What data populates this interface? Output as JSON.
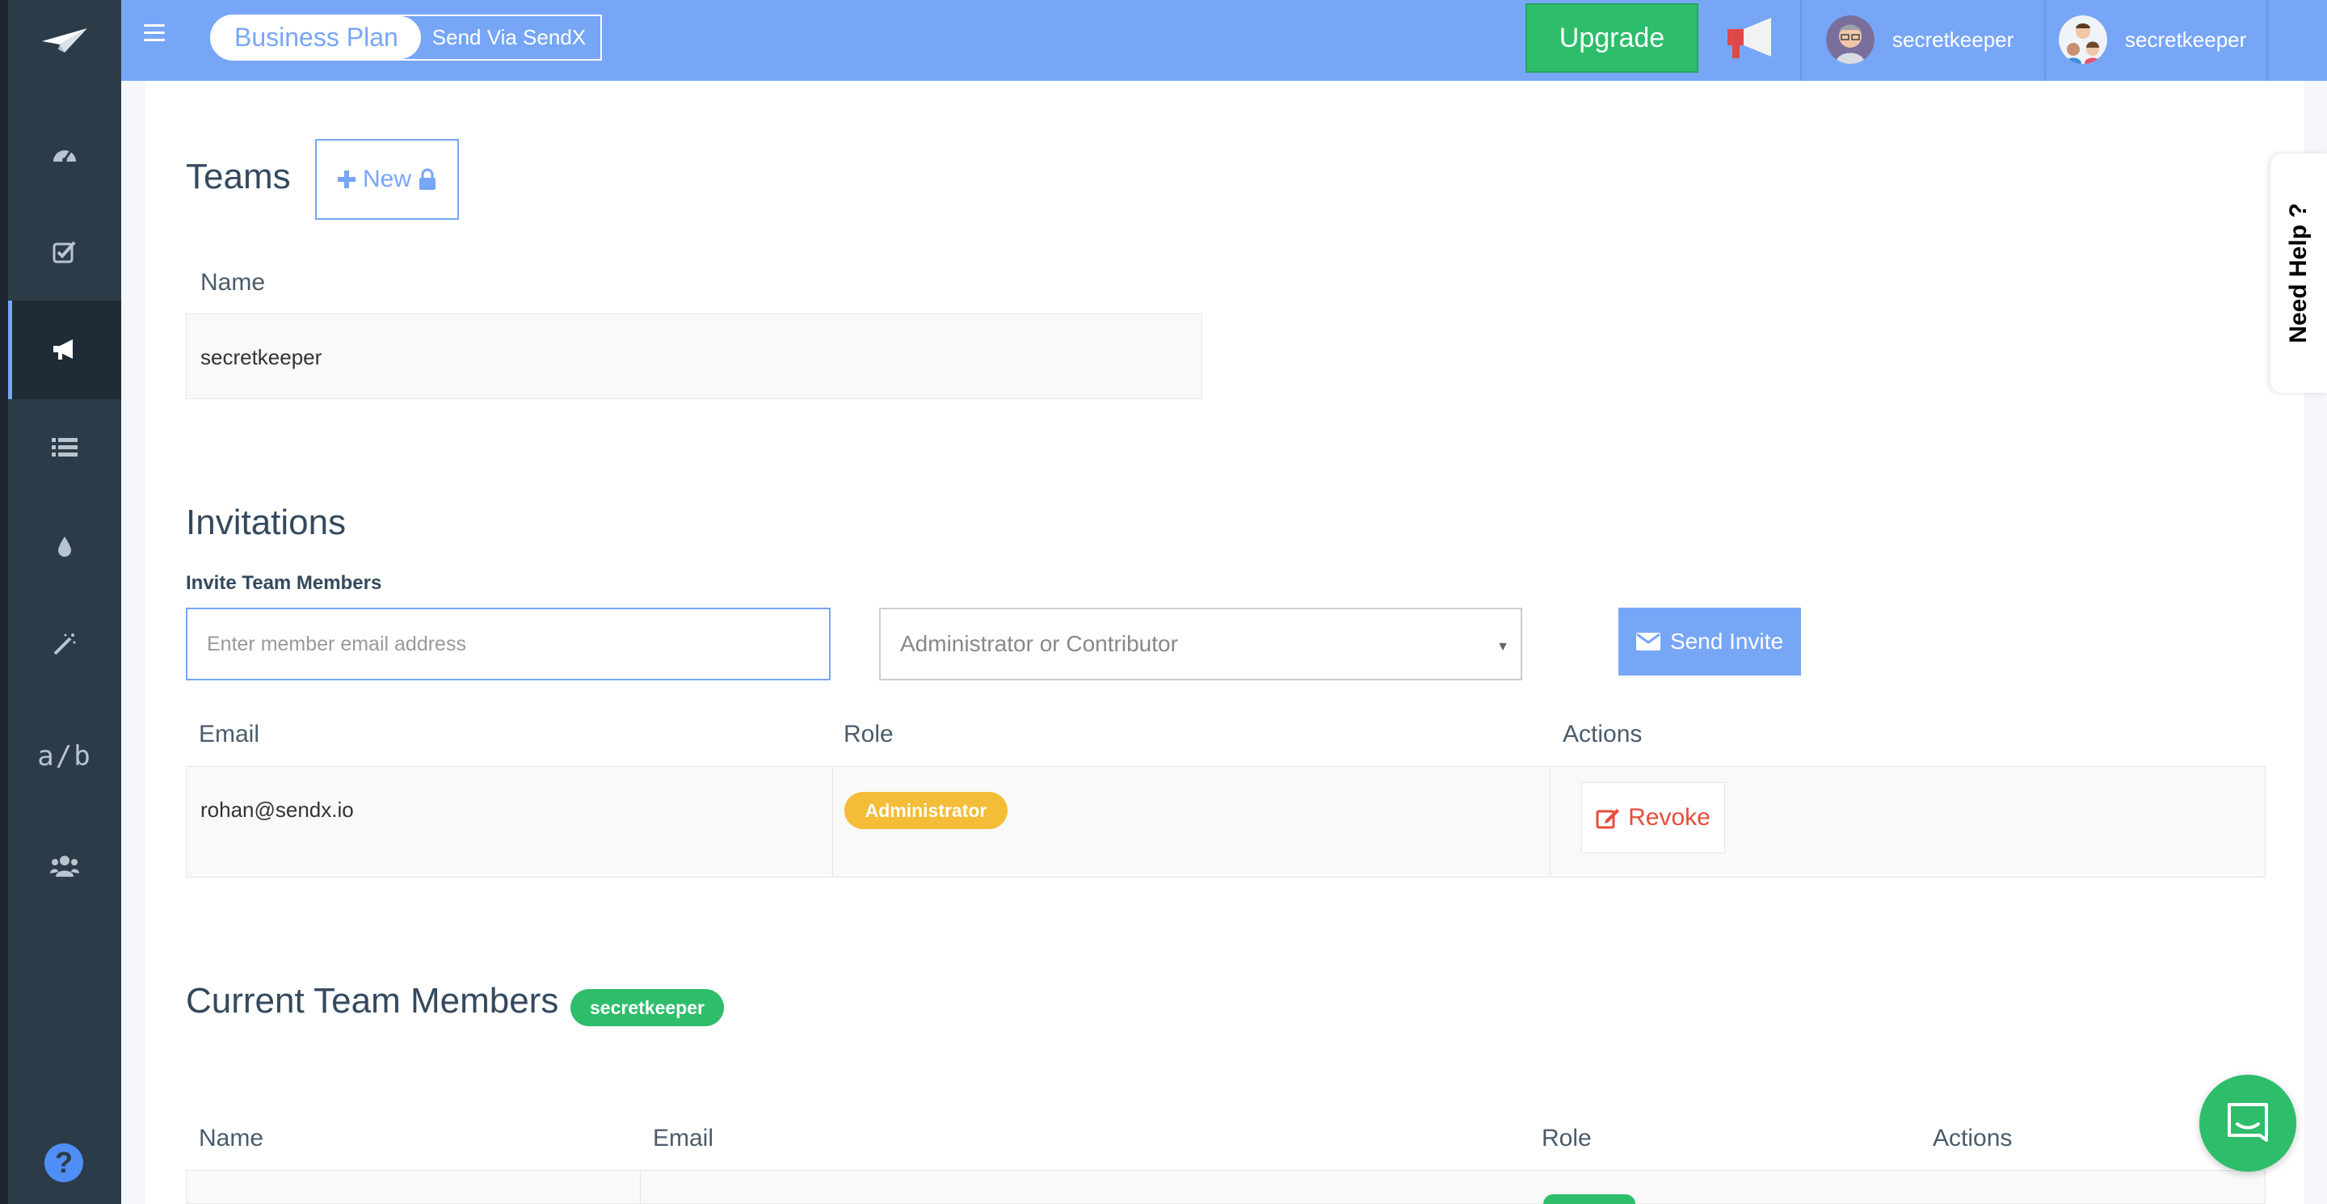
{
  "topbar": {
    "plan_name": "Business Plan",
    "send_via": "Send Via SendX",
    "upgrade_label": "Upgrade",
    "users": [
      {
        "name": "secretkeeper"
      },
      {
        "name": "secretkeeper"
      }
    ]
  },
  "sidebar": {
    "items": [
      {
        "icon": "dashboard-icon"
      },
      {
        "icon": "checkbox-icon"
      },
      {
        "icon": "megaphone-icon",
        "active": true
      },
      {
        "icon": "list-icon"
      },
      {
        "icon": "drop-icon"
      },
      {
        "icon": "magic-wand-icon"
      },
      {
        "icon": "ab-test-icon",
        "label": "a/b"
      },
      {
        "icon": "users-icon"
      }
    ],
    "help_label": "?"
  },
  "teams": {
    "title": "Teams",
    "new_label": "New",
    "column_name": "Name",
    "rows": [
      {
        "name": "secretkeeper"
      }
    ]
  },
  "invitations": {
    "title": "Invitations",
    "invite_label": "Invite Team Members",
    "email_placeholder": "Enter member email address",
    "role_placeholder": "Administrator or Contributor",
    "send_label": "Send Invite",
    "columns": [
      "Email",
      "Role",
      "Actions"
    ],
    "rows": [
      {
        "email": "rohan@sendx.io",
        "role": "Administrator",
        "action": "Revoke"
      }
    ]
  },
  "members": {
    "title": "Current Team Members",
    "team_badge": "secretkeeper",
    "columns": [
      "Name",
      "Email",
      "Role",
      "Actions"
    ]
  },
  "need_help": "Need Help ?",
  "colors": {
    "accent": "#77a6f7",
    "sidebar": "#2c3b48",
    "success": "#2ebd6b",
    "warning": "#f4bc37",
    "danger": "#e74c3c"
  }
}
